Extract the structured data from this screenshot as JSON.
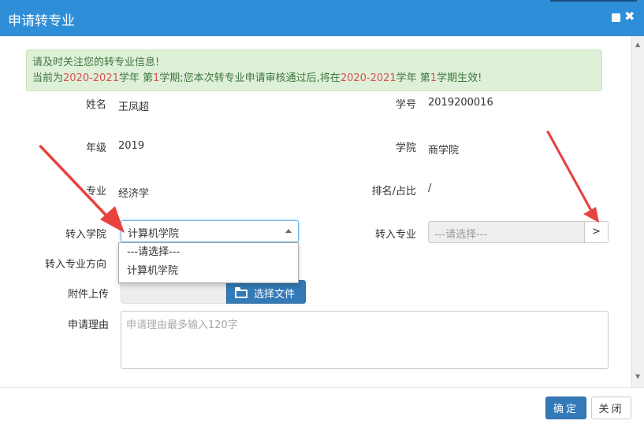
{
  "dialog": {
    "title": "申请转专业"
  },
  "alert": {
    "line1": "请及时关注您的转专业信息!",
    "line2_a": "当前为",
    "year1": "2020-2021",
    "line2_b": "学年 第",
    "term1": "1",
    "line2_c": "学期;您本次转专业申请审核通过后,将在",
    "year2": "2020-2021",
    "line2_d": "学年 第",
    "term2": "1",
    "line2_e": "学期生效!"
  },
  "info": {
    "name_label": "姓名",
    "name_value": "王凤超",
    "id_label": "学号",
    "id_value": "2019200016",
    "grade_label": "年级",
    "grade_value": "2019",
    "college_label": "学院",
    "college_value": "商学院",
    "major_label": "专业",
    "major_value": "经济学",
    "rank_label": "排名/占比",
    "rank_value": "/"
  },
  "form": {
    "target_college_label": "转入学院",
    "target_college_selected": "计算机学院",
    "target_college_options": [
      "---请选择---",
      "计算机学院"
    ],
    "target_major_label": "转入专业",
    "target_major_placeholder": "---请选择---",
    "target_major_button": ">",
    "direction_label": "转入专业方向",
    "attachment_label": "附件上传",
    "attachment_button": "选择文件",
    "reason_label": "申请理由",
    "reason_placeholder": "申请理由最多输入120字"
  },
  "footer": {
    "ok_label": "确定",
    "close_label": "关闭"
  },
  "colors": {
    "titlebar": "#2f8ed8",
    "primary": "#337ab7",
    "alert_bg": "#dff0d8",
    "alert_text": "#3c763d",
    "highlight": "#d9534f",
    "arrow": "#e8423f"
  }
}
